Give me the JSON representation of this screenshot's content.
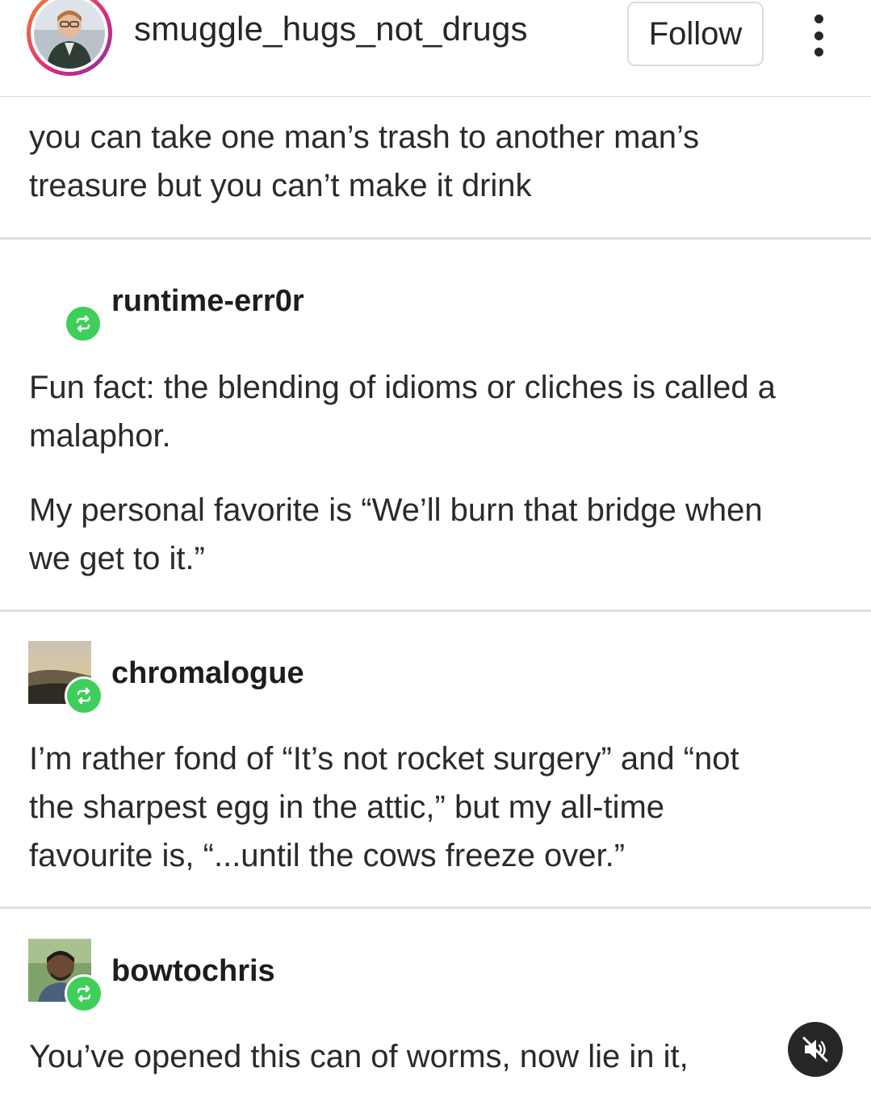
{
  "header": {
    "username": "smuggle_hugs_not_drugs",
    "follow_label": "Follow",
    "more_icon": "more-vertical-icon"
  },
  "posts": [
    {
      "paragraphs": [
        "you can take one man’s trash to another man’s",
        "treasure but you can’t make it drink"
      ]
    },
    {
      "author": "runtime-err0r",
      "paragraphs": [
        "Fun fact: the blending of idioms or cliches is called a",
        "malaphor.",
        "My personal favorite is “We’ll burn that bridge when",
        "we get to it.”"
      ]
    },
    {
      "author": "chromalogue",
      "paragraphs": [
        "I’m rather fond of “It’s not rocket surgery” and “not",
        "the sharpest egg in the attic,” but my all-time",
        "favourite is, “...until the cows freeze over.”"
      ]
    },
    {
      "author": "bowtochris",
      "paragraphs": [
        "You’ve opened this can of worms, now lie in it,"
      ]
    }
  ],
  "icons": {
    "reblog": "reblog-icon",
    "mute": "muted-speaker-icon"
  },
  "colors": {
    "reblog_green": "#3ecf5a",
    "text": "#262626",
    "divider": "#e1e1e1"
  }
}
